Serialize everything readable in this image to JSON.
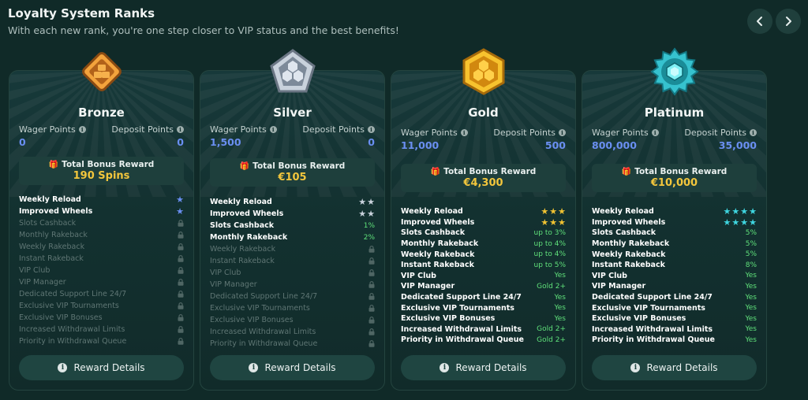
{
  "header": {
    "title": "Loyalty System Ranks",
    "subtitle": "With each new rank, you're one step closer to VIP status and the best benefits!",
    "prev_icon": "chevron-left-icon",
    "next_icon": "chevron-right-icon"
  },
  "labels": {
    "wager_points": "Wager Points",
    "deposit_points": "Deposit Points",
    "total_bonus_reward": "Total Bonus Reward",
    "reward_details": "Reward Details"
  },
  "benefit_names": [
    "Weekly Reload",
    "Improved Wheels",
    "Slots Cashback",
    "Monthly Rakeback",
    "Weekly Rakeback",
    "Instant Rakeback",
    "VIP Club",
    "VIP Manager",
    "Dedicated Support Line 24/7",
    "Exclusive VIP Tournaments",
    "Exclusive VIP Bonuses",
    "Increased Withdrawal Limits",
    "Priority in Withdrawal Queue"
  ],
  "colors": {
    "bronze": "#d88a2e",
    "silver": "#aeb8c4",
    "gold": "#f0b429",
    "platinum": "#3cc9d6",
    "points_blue": "#6a8ff2",
    "reward_gold": "#f3c63c",
    "yes_green": "#5fe07a"
  },
  "ranks": [
    {
      "name": "Bronze",
      "wager": "0",
      "deposit": "0",
      "reward": "190 Spins",
      "badge_icon": "bronze-badge-icon",
      "benefits": [
        {
          "type": "stars",
          "count": 1,
          "color": "#6a8ff2"
        },
        {
          "type": "stars",
          "count": 1,
          "color": "#6a8ff2"
        },
        {
          "type": "lock"
        },
        {
          "type": "lock"
        },
        {
          "type": "lock"
        },
        {
          "type": "lock"
        },
        {
          "type": "lock"
        },
        {
          "type": "lock"
        },
        {
          "type": "lock"
        },
        {
          "type": "lock"
        },
        {
          "type": "lock"
        },
        {
          "type": "lock"
        },
        {
          "type": "lock"
        }
      ]
    },
    {
      "name": "Silver",
      "wager": "1,500",
      "deposit": "0",
      "reward": "€105",
      "badge_icon": "silver-badge-icon",
      "benefits": [
        {
          "type": "stars",
          "count": 2,
          "color": "#c9d2dc"
        },
        {
          "type": "stars",
          "count": 2,
          "color": "#c9d2dc"
        },
        {
          "type": "text",
          "value": "1%"
        },
        {
          "type": "text",
          "value": "2%"
        },
        {
          "type": "lock"
        },
        {
          "type": "lock"
        },
        {
          "type": "lock"
        },
        {
          "type": "lock"
        },
        {
          "type": "lock"
        },
        {
          "type": "lock"
        },
        {
          "type": "lock"
        },
        {
          "type": "lock"
        },
        {
          "type": "lock"
        }
      ]
    },
    {
      "name": "Gold",
      "wager": "11,000",
      "deposit": "500",
      "reward": "€4,300",
      "badge_icon": "gold-badge-icon",
      "benefits": [
        {
          "type": "stars",
          "count": 3,
          "color": "#f0c232"
        },
        {
          "type": "stars",
          "count": 3,
          "color": "#f0c232"
        },
        {
          "type": "text",
          "value": "up to 3%"
        },
        {
          "type": "text",
          "value": "up to 4%"
        },
        {
          "type": "text",
          "value": "up to 4%"
        },
        {
          "type": "text",
          "value": "up to 5%"
        },
        {
          "type": "text",
          "value": "Yes"
        },
        {
          "type": "text",
          "value": "Gold 2+"
        },
        {
          "type": "text",
          "value": "Yes"
        },
        {
          "type": "text",
          "value": "Yes"
        },
        {
          "type": "text",
          "value": "Yes"
        },
        {
          "type": "text",
          "value": "Gold 2+"
        },
        {
          "type": "text",
          "value": "Gold 2+"
        }
      ]
    },
    {
      "name": "Platinum",
      "wager": "800,000",
      "deposit": "35,000",
      "reward": "€10,000",
      "badge_icon": "platinum-badge-icon",
      "benefits": [
        {
          "type": "stars",
          "count": 4,
          "color": "#3fd6e0"
        },
        {
          "type": "stars",
          "count": 4,
          "color": "#3fd6e0"
        },
        {
          "type": "text",
          "value": "5%"
        },
        {
          "type": "text",
          "value": "5%"
        },
        {
          "type": "text",
          "value": "5%"
        },
        {
          "type": "text",
          "value": "8%"
        },
        {
          "type": "text",
          "value": "Yes"
        },
        {
          "type": "text",
          "value": "Yes"
        },
        {
          "type": "text",
          "value": "Yes"
        },
        {
          "type": "text",
          "value": "Yes"
        },
        {
          "type": "text",
          "value": "Yes"
        },
        {
          "type": "text",
          "value": "Yes"
        },
        {
          "type": "text",
          "value": "Yes"
        }
      ]
    }
  ]
}
